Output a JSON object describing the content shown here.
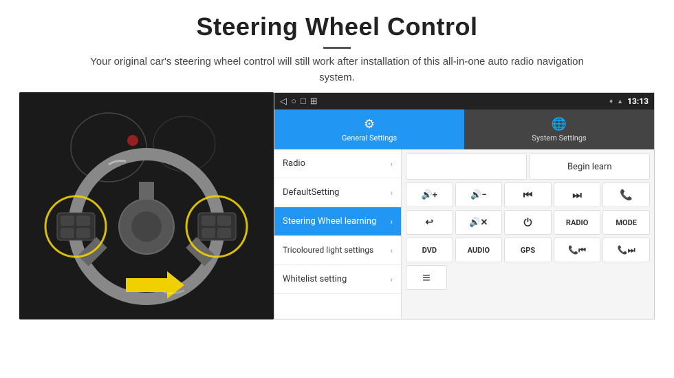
{
  "header": {
    "title": "Steering Wheel Control",
    "subtitle": "Your original car's steering wheel control will still work after installation of this all-in-one auto radio navigation system."
  },
  "status_bar": {
    "nav_back": "◁",
    "nav_home": "○",
    "nav_recent": "□",
    "nav_menu": "⊞",
    "gps_icon": "♦",
    "signal_icon": "▲",
    "time": "13:13"
  },
  "tabs": [
    {
      "id": "general",
      "label": "General Settings",
      "active": true
    },
    {
      "id": "system",
      "label": "System Settings",
      "active": false
    }
  ],
  "menu_items": [
    {
      "id": "radio",
      "label": "Radio",
      "active": false
    },
    {
      "id": "default",
      "label": "DefaultSetting",
      "active": false
    },
    {
      "id": "steering",
      "label": "Steering Wheel learning",
      "active": true
    },
    {
      "id": "tricoloured",
      "label": "Tricoloured light settings",
      "active": false
    },
    {
      "id": "whitelist",
      "label": "Whitelist setting",
      "active": false
    }
  ],
  "controls": {
    "begin_learn": "Begin learn",
    "row1": [
      "🔊+",
      "🔊−",
      "⏮",
      "⏭",
      "📞"
    ],
    "row2": [
      "↩",
      "🔊✕",
      "⏻",
      "RADIO",
      "MODE"
    ],
    "row3": [
      "DVD",
      "AUDIO",
      "GPS",
      "📞⏮",
      "📞⏭"
    ],
    "row4_icon": "≡"
  }
}
